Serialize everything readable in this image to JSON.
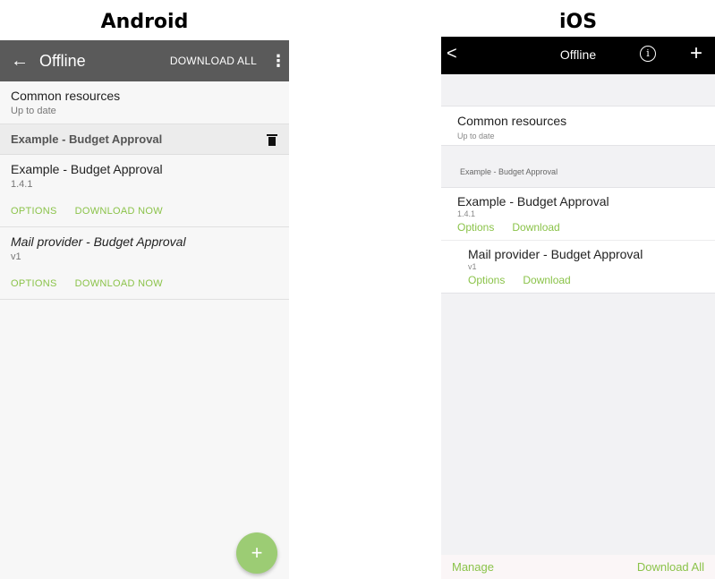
{
  "headings": {
    "android": "Android",
    "ios": "iOS"
  },
  "android": {
    "toolbar": {
      "back": "←",
      "title": "Offline",
      "download_all": "DOWNLOAD ALL",
      "menu": "⋮"
    },
    "common": {
      "title": "Common resources",
      "status": "Up to date"
    },
    "group": {
      "label": "Example - Budget Approval",
      "icon": "trash-icon"
    },
    "items": [
      {
        "title": "Example - Budget Approval",
        "version": "1.4.1",
        "options": "OPTIONS",
        "download": "DOWNLOAD NOW"
      },
      {
        "title": "Mail provider - Budget Approval",
        "version": "v1",
        "options": "OPTIONS",
        "download": "DOWNLOAD NOW"
      }
    ],
    "fab": "+",
    "accent": "#8bc34a"
  },
  "ios": {
    "nav": {
      "back": "<",
      "title": "Offline",
      "info": "i",
      "add": "+"
    },
    "common": {
      "title": "Common resources",
      "status": "Up to date"
    },
    "section_label": "Example - Budget Approval",
    "items": [
      {
        "title": "Example - Budget Approval",
        "version": "1.4.1",
        "options": "Options",
        "download": "Download"
      },
      {
        "title": "Mail provider - Budget Approval",
        "version": "v1",
        "options": "Options",
        "download": "Download"
      }
    ],
    "bottom_bar": {
      "manage": "Manage",
      "download_all": "Download All"
    },
    "accent": "#8bc34a"
  }
}
